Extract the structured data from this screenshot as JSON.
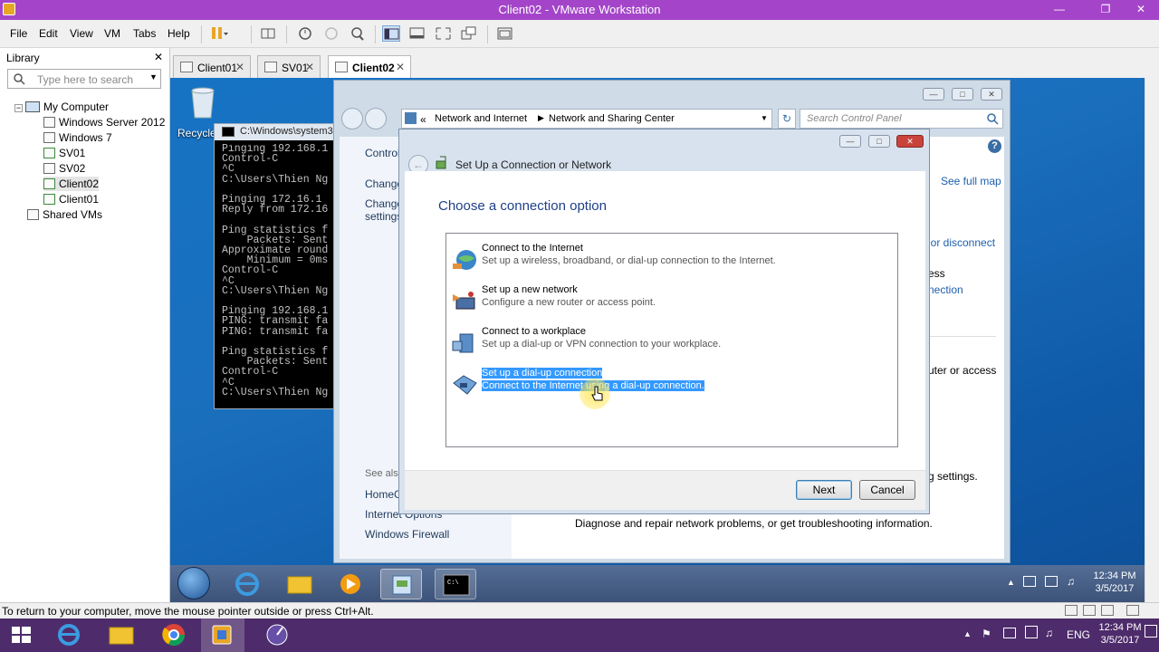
{
  "window": {
    "title": "Client02 - VMware Workstation"
  },
  "menu": [
    "File",
    "Edit",
    "View",
    "VM",
    "Tabs",
    "Help"
  ],
  "library": {
    "header": "Library",
    "search_placeholder": "Type here to search",
    "tree": [
      "My Computer",
      "Windows Server 2012",
      "Windows 7",
      "SV01",
      "SV02",
      "Client02",
      "Client01",
      "Shared VMs"
    ]
  },
  "tabs": [
    {
      "label": "Client01"
    },
    {
      "label": "SV01"
    },
    {
      "label": "Client02"
    }
  ],
  "guest": {
    "recycle_bin": "Recycle",
    "cmd": {
      "title": "C:\\Windows\\system3",
      "lines": "Pinging 192.168.1\nControl-C\n^C\nC:\\Users\\Thien Ng\n\nPinging 172.16.1\nReply from 172.16\n\nPing statistics f\n    Packets: Sent\nApproximate round\n    Minimum = 0ms\nControl-C\n^C\nC:\\Users\\Thien Ng\n\nPinging 192.168.1\nPING: transmit fa\nPING: transmit fa\n\nPing statistics f\n    Packets: Sent\nControl-C\n^C\nC:\\Users\\Thien Ng"
    },
    "nsc": {
      "breadcrumb_prefix": "«",
      "breadcrumb": [
        "Network and Internet",
        "Network and Sharing Center"
      ],
      "search_placeholder": "Search Control Panel",
      "sidebar": [
        "Control",
        "Change",
        "Change",
        "settings"
      ],
      "see_also": "See also",
      "see_also_items": [
        "HomeG",
        "Internet Options",
        "Windows Firewall"
      ],
      "right_links": [
        "See full map",
        "t or disconnect",
        "ess",
        "nection",
        "uter or access",
        "g settings."
      ],
      "diagnose": "Diagnose and repair network problems, or get troubleshooting information."
    },
    "dialog": {
      "title": "Set Up a Connection or Network",
      "heading": "Choose a connection option",
      "options": [
        {
          "title": "Connect to the Internet",
          "desc": "Set up a wireless, broadband, or dial-up connection to the Internet.",
          "selected": false
        },
        {
          "title": "Set up a new network",
          "desc": "Configure a new router or access point.",
          "selected": false
        },
        {
          "title": "Connect to a workplace",
          "desc": "Set up a dial-up or VPN connection to your workplace.",
          "selected": false
        },
        {
          "title": "Set up a dial-up connection",
          "desc": "Connect to the Internet using a dial-up connection.",
          "selected": true
        }
      ],
      "next": "Next",
      "cancel": "Cancel"
    },
    "clock": {
      "time": "12:34 PM",
      "date": "3/5/2017"
    }
  },
  "status": "To return to your computer, move the mouse pointer outside or press Ctrl+Alt.",
  "host": {
    "lang": "ENG",
    "time": "12:34 PM",
    "date": "3/5/2017"
  }
}
